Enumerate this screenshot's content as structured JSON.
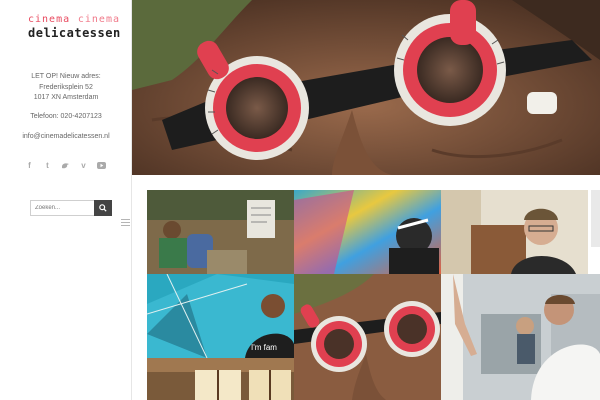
{
  "brand": {
    "logo_word1": "cinema",
    "logo_word2": "cinema",
    "logo_word3": "delicatessen",
    "accent": "#e84a5f"
  },
  "sidebar": {
    "address_line1": "LET OP! Nieuw adres:",
    "address_line2": "Frederiksplein 52",
    "address_line3": "1017 XN Amsterdam",
    "phone": "Telefoon: 020-4207123",
    "email": "info@cinemadelicatessen.nl",
    "socials": [
      "facebook-icon",
      "twitter-icon",
      "vimeo-icon",
      "youtube-icon"
    ],
    "search_placeholder": "Zoeken...",
    "search_icon": "search-icon"
  },
  "grid": {
    "tiles": [
      "market-scene",
      "colorful-blur",
      "smiling-man",
      "tent-scene",
      "eyeglass-trial-frame",
      "lab-coat-man",
      "window-scene"
    ],
    "tshirt_text": "I'm fam"
  }
}
